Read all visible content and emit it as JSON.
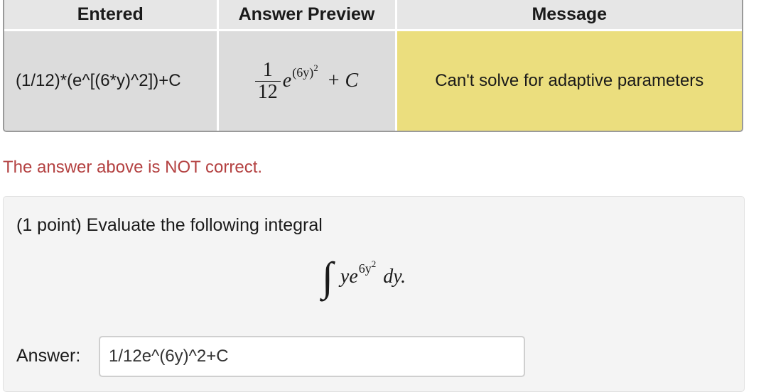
{
  "results_table": {
    "headers": {
      "entered": "Entered",
      "preview": "Answer Preview",
      "message": "Message"
    },
    "row": {
      "entered": "(1/12)*(e^[(6*y)^2])+C",
      "preview": {
        "numerator": "1",
        "denominator": "12",
        "base": "e",
        "exponent": "(6y)",
        "exponent_power": "2",
        "plus": "+",
        "constant": "C"
      },
      "message": "Can't solve for adaptive parameters"
    },
    "colors": {
      "header_bg": "#e6e6e6",
      "cell_bg": "#dcdcdc",
      "message_bg": "#ebde7e"
    }
  },
  "verdict": {
    "text": "The answer above is NOT correct.",
    "color": "#b44242"
  },
  "problem": {
    "prompt": "(1 point) Evaluate the following integral",
    "integral": {
      "sign": "∫",
      "integrand_base": "ye",
      "exponent": "6y",
      "exponent_power": "2",
      "differential": "dy."
    },
    "answer_label": "Answer:",
    "answer_value": "1/12e^(6y)^2+C"
  }
}
